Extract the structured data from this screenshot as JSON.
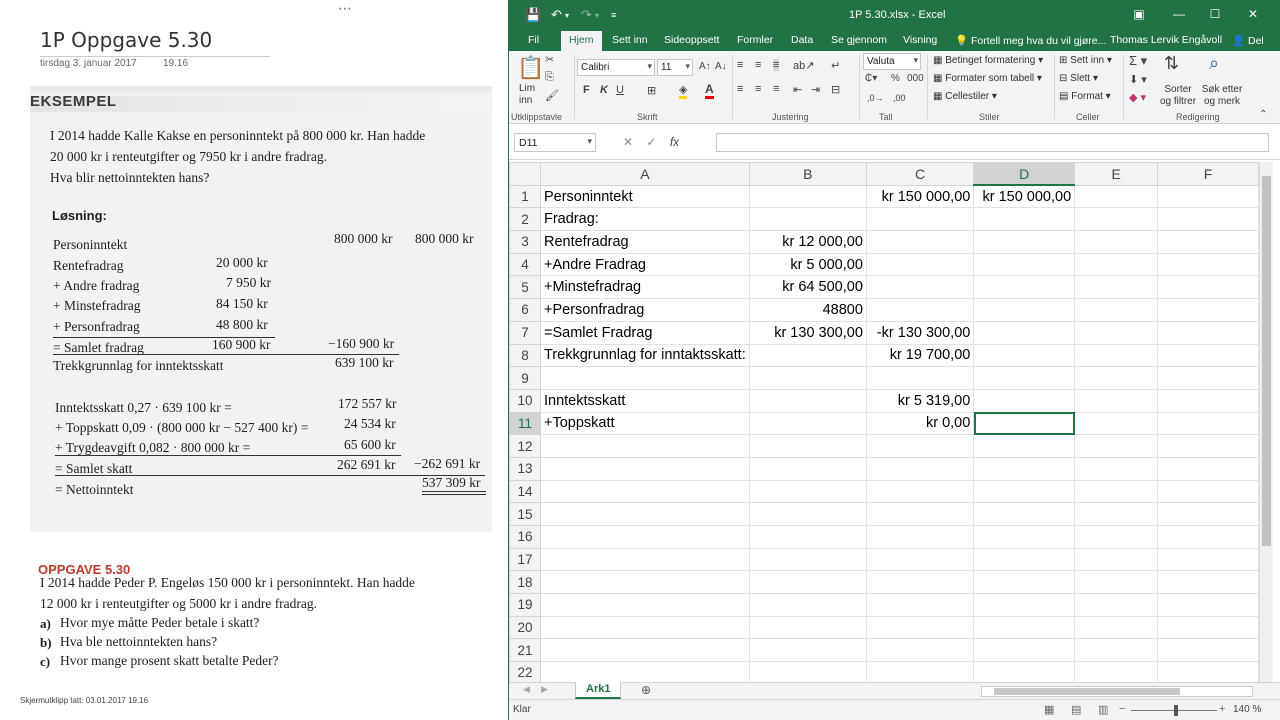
{
  "onenote": {
    "title": "1P Oppgave 5.30",
    "date": "tirsdag 3. januar 2017",
    "time": "19.16",
    "footnote": "Skjermutklipp tatt: 03.01.2017 19.16",
    "example": {
      "heading": "EKSEMPEL",
      "intro": [
        "I 2014 hadde Kalle Kakse en personinntekt på 800 000 kr. Han hadde",
        "20 000 kr i renteutgifter og 7950 kr i andre fradrag.",
        "Hva blir nettoinntekten hans?"
      ],
      "solution_label": "Løsning:",
      "rows": [
        {
          "label": "Personinntekt",
          "mid": "",
          "right": "800 000 kr",
          "far": "800 000 kr"
        },
        {
          "label": "Rentefradrag",
          "mid": "20 000 kr",
          "right": "",
          "far": ""
        },
        {
          "label": "+ Andre fradrag",
          "mid": "7 950 kr",
          "right": "",
          "far": ""
        },
        {
          "label": "+ Minstefradrag",
          "mid": "84 150 kr",
          "right": "",
          "far": ""
        },
        {
          "label": "+ Personfradrag",
          "mid": "48 800 kr",
          "right": "",
          "far": ""
        },
        {
          "label": "= Samlet fradrag",
          "mid": "160 900 kr",
          "right": "−160 900 kr",
          "far": ""
        },
        {
          "label": "Trekkgrunnlag for inntektsskatt",
          "mid": "",
          "right": "639 100 kr",
          "far": ""
        }
      ],
      "tax_rows": [
        {
          "label": "Inntektsskatt 0,27 · 639 100 kr =",
          "right": "172 557 kr",
          "far": ""
        },
        {
          "label": "+ Toppskatt 0,09 · (800 000 kr − 527 400 kr) =",
          "right": "24 534 kr",
          "far": ""
        },
        {
          "label": "+ Trygdeavgift 0,082 · 800 000 kr =",
          "right": "65 600 kr",
          "far": ""
        },
        {
          "label": "= Samlet skatt",
          "right": "262 691 kr",
          "far": "−262 691 kr"
        },
        {
          "label": "= Nettoinntekt",
          "right": "",
          "far": "537 309 kr"
        }
      ]
    },
    "task": {
      "heading": "OPPGAVE 5.30",
      "lines": [
        "I 2014 hadde Peder P. Engeløs 150 000 kr i personinntekt. Han hadde",
        "12 000 kr i renteutgifter og 5000 kr i andre fradrag."
      ],
      "questions": [
        {
          "letter": "a)",
          "text": "Hvor mye måtte Peder betale i skatt?"
        },
        {
          "letter": "b)",
          "text": "Hva ble nettoinntekten hans?"
        },
        {
          "letter": "c)",
          "text": "Hvor mange prosent skatt betalte Peder?"
        }
      ]
    }
  },
  "excel": {
    "window_title": "1P 5.30.xlsx - Excel",
    "tabs": [
      "Fil",
      "Hjem",
      "Sett inn",
      "Sideoppsett",
      "Formler",
      "Data",
      "Se gjennom",
      "Visning"
    ],
    "active_tab": "Hjem",
    "tell_me": "Fortell meg hva du vil gjøre...",
    "user": "Thomas Lervik Engåvoll",
    "share": "Del",
    "ribbon": {
      "paste": "Lim inn",
      "font_name": "Calibri",
      "font_size": "11",
      "number_format": "Valuta",
      "conditional": "Betinget formatering",
      "format_table": "Formater som tabell",
      "cell_styles": "Cellestiler",
      "insert": "Sett inn",
      "delete": "Slett",
      "format": "Format",
      "sort": "Sorter og filtrer",
      "find": "Søk etter og merk",
      "groups": [
        "Utklippstavle",
        "Skrift",
        "Justering",
        "Tall",
        "Stiler",
        "Celler",
        "Redigering"
      ]
    },
    "name_box": "D11",
    "columns": [
      "A",
      "B",
      "C",
      "D",
      "E",
      "F"
    ],
    "selected_column": "D",
    "selected_row": 11,
    "rows": [
      {
        "n": "1",
        "A": "Personinntekt",
        "B": "",
        "C": "kr 150 000,00",
        "D": "kr 150 000,00"
      },
      {
        "n": "2",
        "A": "Fradrag:",
        "B": "",
        "C": "",
        "D": ""
      },
      {
        "n": "3",
        "A": "Rentefradrag",
        "B": "kr 12 000,00",
        "C": "",
        "D": ""
      },
      {
        "n": "4",
        "A": "+Andre Fradrag",
        "B": "kr 5 000,00",
        "C": "",
        "D": ""
      },
      {
        "n": "5",
        "A": "+Minstefradrag",
        "B": "kr 64 500,00",
        "C": "",
        "D": ""
      },
      {
        "n": "6",
        "A": "+Personfradrag",
        "B": "48800",
        "C": "",
        "D": ""
      },
      {
        "n": "7",
        "A": "=Samlet Fradrag",
        "B": "kr 130 300,00",
        "C": "-kr 130 300,00",
        "D": ""
      },
      {
        "n": "8",
        "A": "Trekkgrunnlag for inntaktsskatt:",
        "B": "",
        "C": "kr 19 700,00",
        "D": ""
      },
      {
        "n": "9",
        "A": "",
        "B": "",
        "C": "",
        "D": ""
      },
      {
        "n": "10",
        "A": "Inntektsskatt",
        "B": "",
        "C": "kr 5 319,00",
        "D": ""
      },
      {
        "n": "11",
        "A": "+Toppskatt",
        "B": "",
        "C": "kr 0,00",
        "D": ""
      },
      {
        "n": "12",
        "A": "",
        "B": "",
        "C": "",
        "D": ""
      },
      {
        "n": "13",
        "A": "",
        "B": "",
        "C": "",
        "D": ""
      },
      {
        "n": "14",
        "A": "",
        "B": "",
        "C": "",
        "D": ""
      },
      {
        "n": "15",
        "A": "",
        "B": "",
        "C": "",
        "D": ""
      },
      {
        "n": "16",
        "A": "",
        "B": "",
        "C": "",
        "D": ""
      },
      {
        "n": "17",
        "A": "",
        "B": "",
        "C": "",
        "D": ""
      },
      {
        "n": "18",
        "A": "",
        "B": "",
        "C": "",
        "D": ""
      },
      {
        "n": "19",
        "A": "",
        "B": "",
        "C": "",
        "D": ""
      },
      {
        "n": "20",
        "A": "",
        "B": "",
        "C": "",
        "D": ""
      },
      {
        "n": "21",
        "A": "",
        "B": "",
        "C": "",
        "D": ""
      },
      {
        "n": "22",
        "A": "",
        "B": "",
        "C": "",
        "D": ""
      }
    ],
    "sheet_tab": "Ark1",
    "status": "Klar",
    "zoom": "140 %"
  }
}
